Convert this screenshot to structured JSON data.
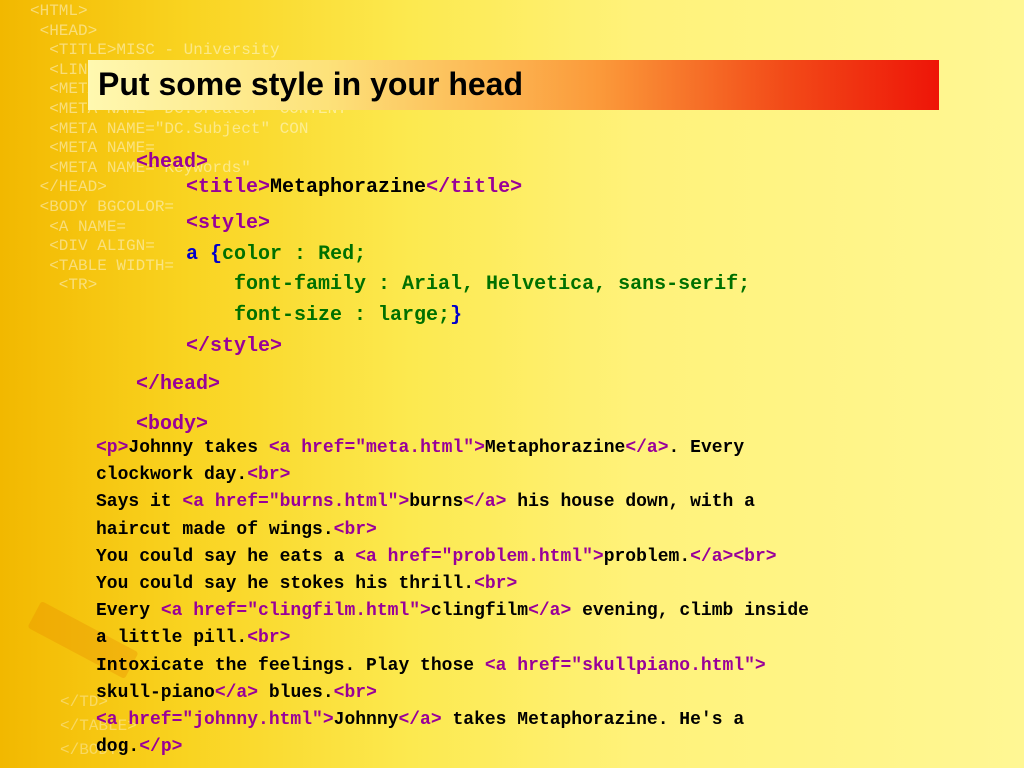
{
  "slide": {
    "title": "Put some style in your head"
  },
  "background_code": [
    "<HTML>",
    " <HEAD>",
    "  <TITLE>MISC - University",
    "  <LINK",
    "  <META NAME=",
    "  <META NAME=\"DC.Creator\" CONTENT",
    "  <META NAME=\"DC.Subject\" CON",
    "  <META NAME=",
    "  <META NAME=\"Keywords\"",
    " </HEAD>",
    " <BODY BGCOLOR=",
    "  <A NAME=",
    "  <DIV ALIGN=",
    "  <TABLE WIDTH=",
    "   <TR>"
  ],
  "background_code_bottom": [
    "</TD>",
    "</TABLE>",
    "</BODY>"
  ],
  "head_block": {
    "line_head_open": "<head>",
    "title_open": "<title>",
    "title_text": "Metaphorazine",
    "title_close": "</title>",
    "style_open": "<style>",
    "css_selector": "a",
    "css_brace_open": " {",
    "css_decl_1": "color : Red;",
    "css_decl_2": "font-family : Arial, Helvetica, sans-serif;",
    "css_decl_3": "font-size : large;",
    "css_brace_close": "}",
    "style_close": "</style>",
    "line_head_close": "</head>",
    "line_body_open": "<body>"
  },
  "body_block": {
    "l1_p_open": "<p>",
    "l1_text_a": "Johnny takes ",
    "l1_a_open": "<a href=\"meta.html\">",
    "l1_link": "Metaphorazine",
    "l1_a_close": "</a>",
    "l1_text_b": ". Every",
    "l2_text": "clockwork day.",
    "l2_br": "<br>",
    "l3_text_a": "Says it ",
    "l3_a_open": "<a href=\"burns.html\">",
    "l3_link": "burns",
    "l3_a_close": "</a>",
    "l3_text_b": " his house down, with a",
    "l4_text": "haircut made of wings.",
    "l4_br": "<br>",
    "l5_text_a": "You could say he eats a ",
    "l5_a_open": "<a href=\"problem.html\">",
    "l5_link": "problem.",
    "l5_a_close": "</a>",
    "l5_br": "<br>",
    "l6_text": "You could say he stokes his thrill.",
    "l6_br": "<br>",
    "l7_text_a": "Every ",
    "l7_a_open": "<a href=\"clingfilm.html\">",
    "l7_link": "clingfilm",
    "l7_a_close": "</a>",
    "l7_text_b": " evening, climb inside",
    "l8_text": "a little pill.",
    "l8_br": "<br>",
    "l9_text_a": "Intoxicate the feelings. Play those ",
    "l9_a_open": "<a href=\"skullpiano.html\">",
    "l10_link": "skull-piano",
    "l10_a_close": "</a>",
    "l10_text_b": " blues.",
    "l10_br": "<br>",
    "l11_a_open": "<a href=\"johnny.html\">",
    "l11_link": "Johnny",
    "l11_a_close": "</a>",
    "l11_text_b": " takes Metaphorazine. He's a",
    "l12_text": "dog.",
    "l12_p_close": "</p>"
  }
}
